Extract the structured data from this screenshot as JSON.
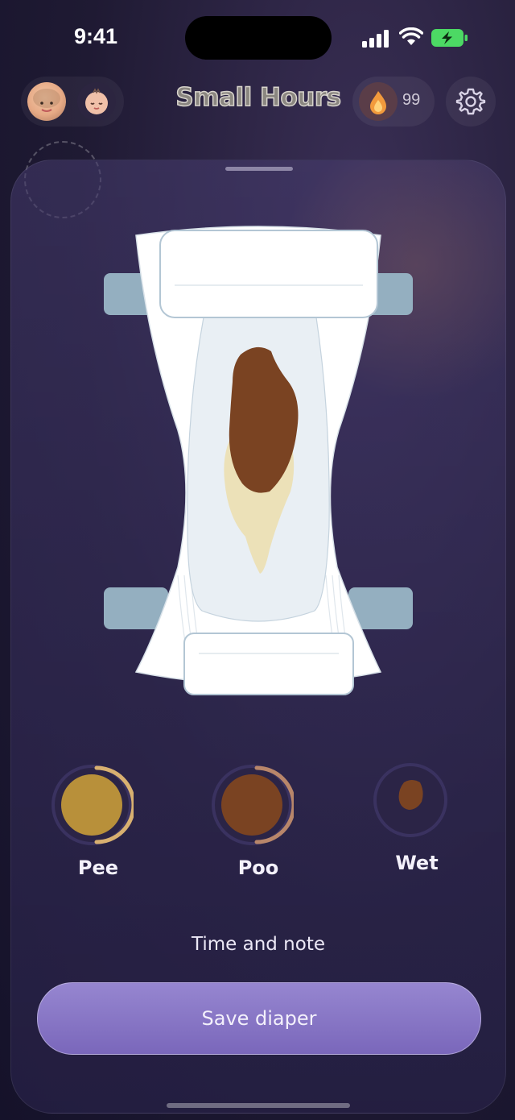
{
  "status": {
    "time": "9:41"
  },
  "header": {
    "title": "Small Hours",
    "streak_count": "99"
  },
  "diaper_options": [
    {
      "label": "Pee",
      "color": "#b8903a"
    },
    {
      "label": "Poo",
      "color": "#7a4322"
    },
    {
      "label": "Wet",
      "color": "#7a4322"
    }
  ],
  "footer": {
    "time_note_label": "Time and note",
    "save_label": "Save diaper"
  },
  "colors": {
    "accent": "#8a78c6",
    "battery": "#4cd964",
    "stain_poo": "#7a4322",
    "stain_pee": "#ece1b8"
  }
}
